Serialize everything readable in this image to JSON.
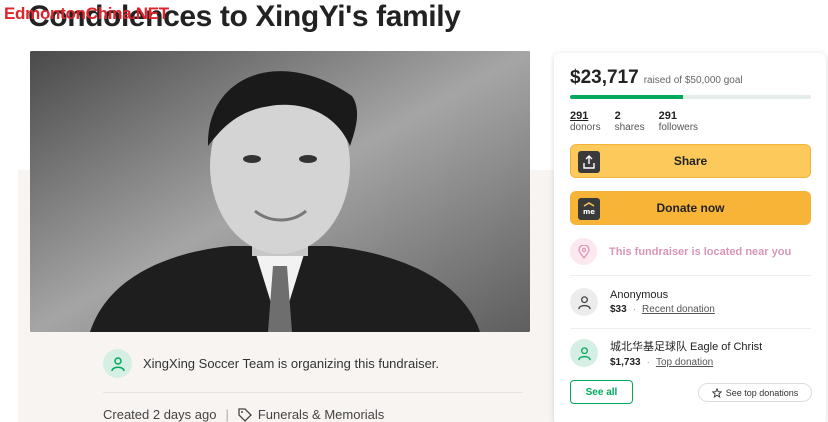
{
  "watermark": "EdmontonChina.NET",
  "page": {
    "title": "Condolences to XingYi's family"
  },
  "organizer": {
    "text": "XingXing Soccer Team is organizing this fundraiser."
  },
  "meta": {
    "created": "Created 2 days ago",
    "category": "Funerals & Memorials"
  },
  "donation_card": {
    "raised_amount": "$23,717",
    "raised_goal": "raised of $50,000 goal",
    "progress_fraction": 0.47,
    "stats": {
      "donors": {
        "num": "291",
        "label": "donors"
      },
      "shares": {
        "num": "2",
        "label": "shares"
      },
      "followers": {
        "num": "291",
        "label": "followers"
      }
    },
    "share_label": "Share",
    "donate_label": "Donate now",
    "near_text": "This fundraiser is located near you",
    "donors": [
      {
        "name": "Anonymous",
        "amount": "$33",
        "tag": "Recent donation"
      },
      {
        "name": "城北华基足球队 Eagle of Christ",
        "amount": "$1,733",
        "tag": "Top donation"
      }
    ],
    "see_all_label": "See all",
    "see_top_label": "See top donations"
  },
  "colors": {
    "brand_green": "#02a95c",
    "button_yellow": "#fdc95a",
    "watermark_red": "#e0242b",
    "near_pink": "#d996b6"
  },
  "icons": [
    "share-icon",
    "gofundme-me-icon",
    "location-pin-icon",
    "person-icon",
    "tag-icon",
    "star-icon"
  ]
}
